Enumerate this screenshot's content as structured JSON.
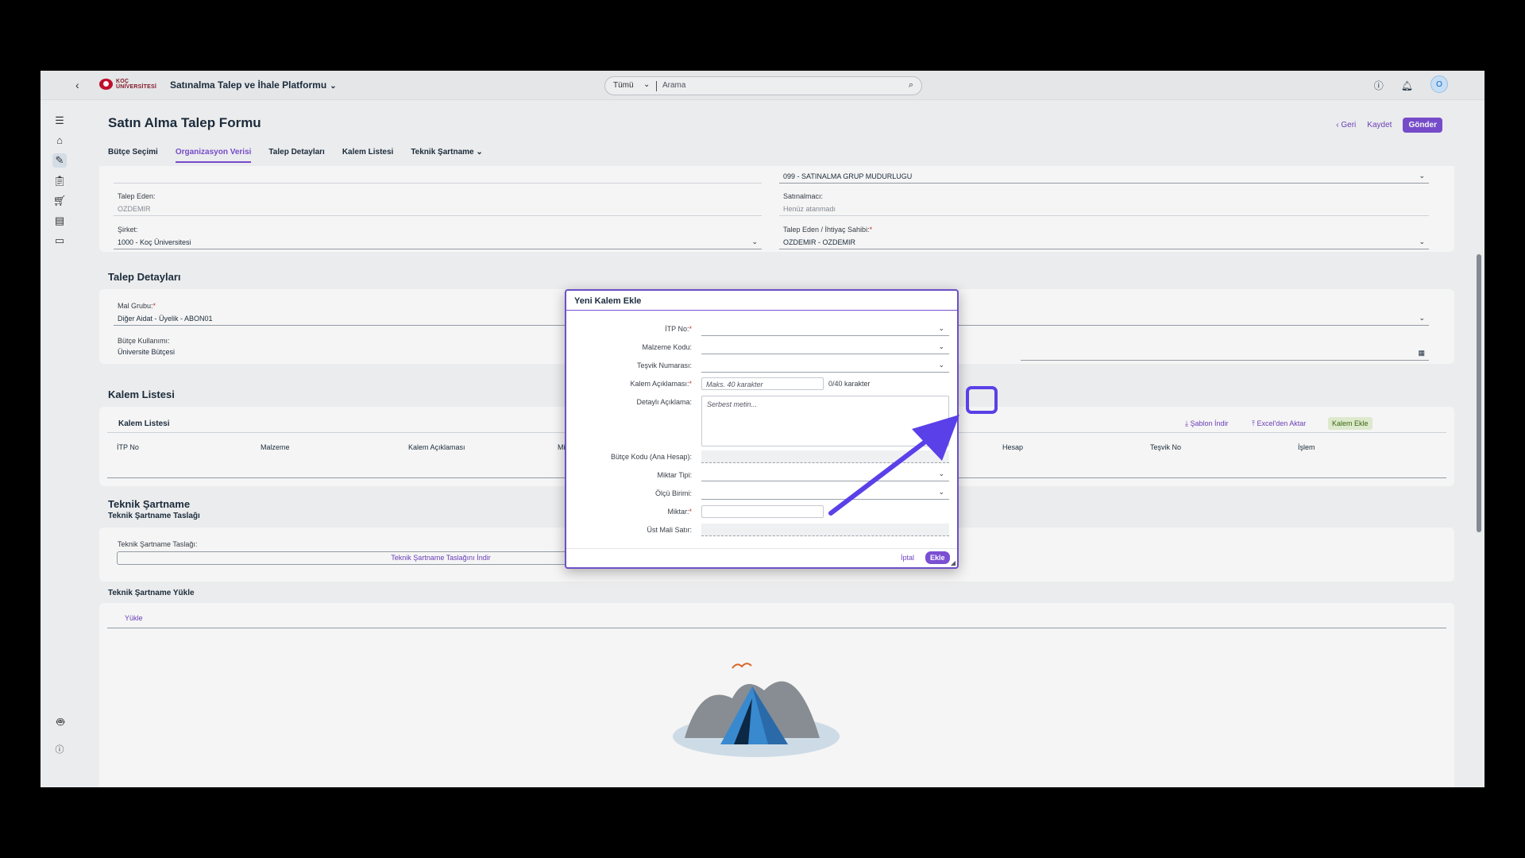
{
  "shell": {
    "logo_text_1": "KOÇ",
    "logo_text_2": "ÜNİVERSİTESİ",
    "app_title": "Satınalma Talep ve İhale Platformu",
    "search_scope": "Tümü",
    "search_placeholder": "Arama",
    "avatar_initial": "O"
  },
  "header": {
    "title": "Satın Alma Talep Formu",
    "back_label": "Geri",
    "save_label": "Kaydet",
    "send_label": "Gönder"
  },
  "tabs": [
    "Bütçe Seçimi",
    "Organizasyon Verisi",
    "Talep Detayları",
    "Kalem Listesi",
    "Teknik Şartname"
  ],
  "org": {
    "purchasing_group_value": "099 - SATINALMA GRUP MUDURLUGU",
    "requester_label": "Talep Eden:",
    "requester_value": "OZDEMIR",
    "buyer_label": "Satınalmacı:",
    "buyer_value": "Henüz atanmadı",
    "company_label": "Şirket:",
    "company_value": "1000 - Koç Üniversitesi",
    "owner_label": "Talep Eden / İhtiyaç Sahibi:",
    "owner_value": "OZDEMIR - OZDEMIR"
  },
  "details": {
    "title": "Talep Detayları",
    "material_group_label": "Mal Grubu:",
    "material_group_value": "Diğer Aidat - Üyelik - ABON01",
    "budget_use_label": "Bütçe Kullanımı:",
    "budget_use_value": "Üniversite Bütçesi"
  },
  "items": {
    "title": "Kalem Listesi",
    "table_title": "Kalem Listesi",
    "template_download": "Şablon İndir",
    "excel_import": "Excel'den Aktar",
    "add_item": "Kalem Ekle",
    "columns": [
      "İTP No",
      "Malzeme",
      "Kalem Açıklaması",
      "Mi",
      "Hesap",
      "Teşvik No",
      "İşlem"
    ]
  },
  "spec": {
    "title": "Teknik Şartname",
    "subtitle": "Teknik Şartname Taslağı",
    "draft_label": "Teknik Şartname Taslağı:",
    "draft_download": "Teknik Şartname Taslağını İndir",
    "upload_title": "Teknik Şartname Yükle",
    "upload_label": "Yükle"
  },
  "dialog": {
    "title": "Yeni Kalem Ekle",
    "itp_label": "İTP No:",
    "material_code_label": "Malzeme Kodu:",
    "incentive_label": "Teşvik Numarası:",
    "item_desc_label": "Kalem Açıklaması:",
    "item_desc_placeholder": "Maks. 40 karakter",
    "item_desc_counter": "0/40 karakter",
    "detail_desc_label": "Detaylı Açıklama:",
    "detail_desc_placeholder": "Serbest metin...",
    "budget_code_label": "Bütçe Kodu (Ana Hesap):",
    "qty_type_label": "Miktar Tipi:",
    "unit_label": "Ölçü Birimi:",
    "qty_label": "Miktar:",
    "parent_line_label": "Üst Mali Satır:",
    "cancel_label": "İptal",
    "add_label": "Ekle"
  },
  "colors": {
    "accent": "#7b4fd3",
    "highlight": "#5a40e8",
    "required": "#c0392b"
  }
}
